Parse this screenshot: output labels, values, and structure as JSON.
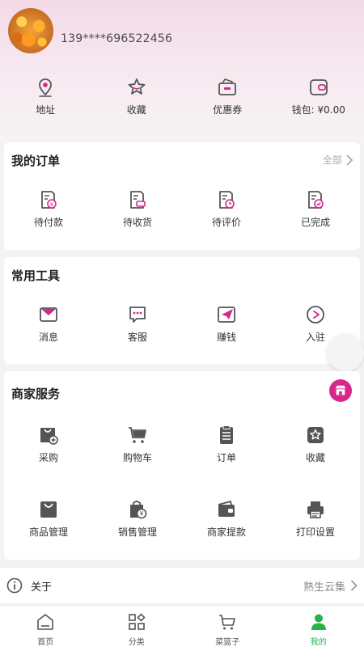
{
  "profile": {
    "phone": "139****696522456"
  },
  "quick": [
    {
      "label": "地址",
      "icon": "location-icon"
    },
    {
      "label": "收藏",
      "icon": "star-icon"
    },
    {
      "label": "优惠券",
      "icon": "coupon-icon"
    },
    {
      "label": "钱包: ¥0.00",
      "icon": "wallet-icon"
    }
  ],
  "orders": {
    "title": "我的订单",
    "more": "全部",
    "items": [
      {
        "label": "待付款",
        "icon": "pending-payment-icon"
      },
      {
        "label": "待收货",
        "icon": "pending-receipt-icon"
      },
      {
        "label": "待评价",
        "icon": "pending-review-icon"
      },
      {
        "label": "已完成",
        "icon": "completed-icon"
      }
    ]
  },
  "tools": {
    "title": "常用工具",
    "items": [
      {
        "label": "消息",
        "icon": "message-icon"
      },
      {
        "label": "客服",
        "icon": "customer-service-icon"
      },
      {
        "label": "赚钱",
        "icon": "earn-money-icon"
      },
      {
        "label": "入驻",
        "icon": "join-icon"
      }
    ]
  },
  "merchant": {
    "title": "商家服务",
    "row1": [
      {
        "label": "采购",
        "icon": "purchase-icon"
      },
      {
        "label": "购物车",
        "icon": "cart-icon"
      },
      {
        "label": "订单",
        "icon": "order-list-icon"
      },
      {
        "label": "收藏",
        "icon": "favorite-box-icon"
      }
    ],
    "row2": [
      {
        "label": "商品管理",
        "icon": "product-management-icon"
      },
      {
        "label": "销售管理",
        "icon": "sales-management-icon"
      },
      {
        "label": "商家提款",
        "icon": "withdraw-icon"
      },
      {
        "label": "打印设置",
        "icon": "printer-icon"
      }
    ]
  },
  "about": {
    "title": "关于",
    "right": "熟生云集"
  },
  "tabbar": [
    {
      "label": "首页",
      "icon": "home-icon"
    },
    {
      "label": "分类",
      "icon": "category-icon"
    },
    {
      "label": "菜篮子",
      "icon": "basket-icon"
    },
    {
      "label": "我的",
      "icon": "profile-icon",
      "active": true
    }
  ],
  "colors": {
    "accent_pink": "#d8278a",
    "icon_dark": "#555555",
    "active_green": "#27b34b"
  }
}
